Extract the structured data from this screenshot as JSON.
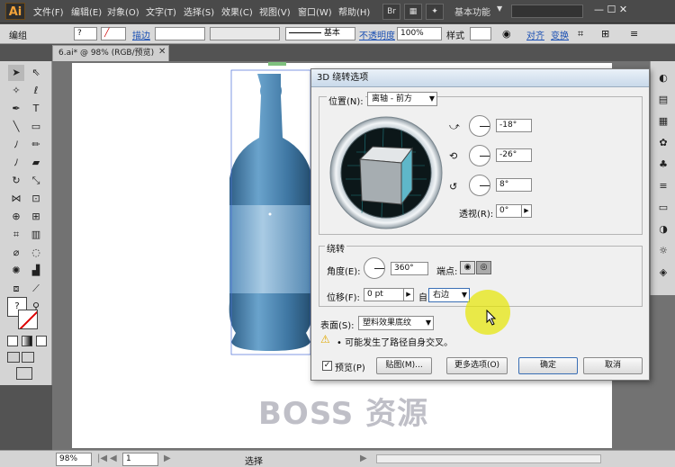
{
  "app": {
    "logo": "Ai",
    "workspace": "基本功能",
    "window_controls": "— ☐ ✕"
  },
  "menu": [
    "文件(F)",
    "编辑(E)",
    "对象(O)",
    "文字(T)",
    "选择(S)",
    "效果(C)",
    "视图(V)",
    "窗口(W)",
    "帮助(H)"
  ],
  "control_bar": {
    "selection": "编组",
    "stroke_label": "描边",
    "stroke_style": "基本",
    "opacity_label": "不透明度",
    "opacity_value": "100%",
    "style_label": "样式",
    "align_label": "对齐",
    "transform_label": "变换"
  },
  "document_tab": {
    "title": "6.ai* @ 98% (RGB/预览)",
    "close": "✕"
  },
  "status_bar": {
    "zoom": "98%",
    "page": "1",
    "tool": "选择"
  },
  "dialog": {
    "title": "3D 绕转选项",
    "position_label": "位置(N):",
    "position_value": "离轴 - 前方",
    "x_angle": "-18°",
    "y_angle": "-26°",
    "z_angle": "8°",
    "perspective_label": "透视(R):",
    "perspective_value": "0°",
    "revolve_group": "绕转",
    "angle_label": "角度(E):",
    "angle_value": "360°",
    "cap_label": "端点:",
    "offset_label": "位移(F):",
    "offset_value": "0 pt",
    "from_label": "自",
    "from_value": "右边",
    "surface_label": "表面(S):",
    "surface_value": "塑料效果底纹",
    "warning": "• 可能发生了路径自身交叉。",
    "preview_label": "预览(P)",
    "map_button": "贴图(M)...",
    "more_options_button": "更多选项(O)",
    "ok_button": "确定",
    "cancel_button": "取消"
  },
  "watermark": "BOSS 资源",
  "colors": {
    "bottle": "#4a86b5",
    "label": "#86b4d6",
    "cube_face": "#5fb7c9",
    "dialog_bg": "#f0f0f0",
    "highlight": "#e6e600"
  }
}
